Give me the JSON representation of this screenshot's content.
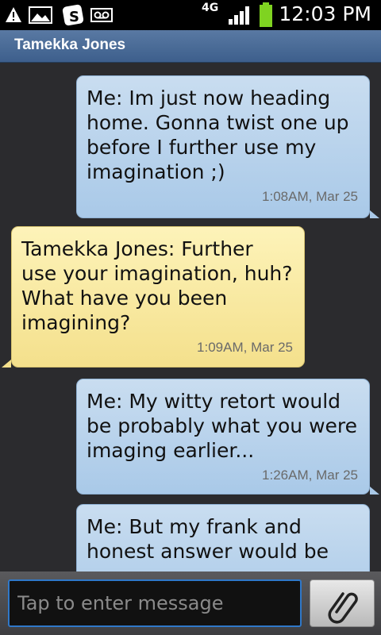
{
  "status_bar": {
    "time": "12:03 PM",
    "network_label": "4G",
    "icons": [
      "warning-icon",
      "picture-icon",
      "app-icon",
      "voicemail-icon",
      "signal-icon",
      "battery-icon"
    ]
  },
  "header": {
    "contact_name": "Tamekka Jones"
  },
  "messages": [
    {
      "direction": "sent",
      "text": "Me: Im just now heading home. Gonna twist one up before I further use my imagination ;)",
      "timestamp": "1:08AM, Mar 25"
    },
    {
      "direction": "received",
      "text": "Tamekka Jones: Further use your imagination, huh? What have you been imagining?",
      "timestamp": "1:09AM, Mar 25"
    },
    {
      "direction": "sent",
      "text": "Me: My witty retort would be probably what you were imaging earlier...",
      "timestamp": "1:26AM, Mar 25"
    },
    {
      "direction": "sent",
      "text": "Me: But my frank and honest answer would be",
      "timestamp": ""
    }
  ],
  "composer": {
    "placeholder": "Tap to enter message",
    "value": "",
    "attach_icon": "paperclip-icon"
  },
  "colors": {
    "sent_bubble": "#b8d3ee",
    "received_bubble": "#f8e9a2",
    "header": "#4a6b96",
    "input_focus": "#2f78c9"
  }
}
